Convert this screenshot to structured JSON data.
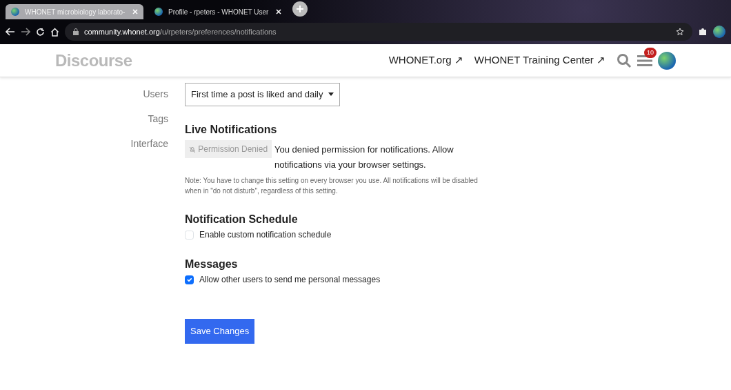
{
  "browser": {
    "tabs": [
      {
        "title": "WHONET microbiology laborato-",
        "selected": true
      },
      {
        "title": "Profile - rpeters - WHONET User",
        "selected": false
      }
    ],
    "address": {
      "host": "community.whonet.org",
      "path": "/u/rpeters/preferences/notifications"
    }
  },
  "header": {
    "logo": "Discourse",
    "links": [
      "WHONET.org ↗",
      "WHONET Training Center ↗"
    ],
    "notification_count": "10"
  },
  "sidebar": {
    "items": [
      "Users",
      "Tags",
      "Interface"
    ]
  },
  "like_notify": {
    "value": "First time a post is liked and daily"
  },
  "live_notifications": {
    "title": "Live Notifications",
    "button": {
      "label": "Permission Denied",
      "disabled": true
    },
    "message": "You denied permission for notifications. Allow notifications via your browser settings.",
    "note": "Note: You have to change this setting on every browser you use. All notifications will be disabled when in \"do not disturb\", regardless of this setting."
  },
  "notification_schedule": {
    "title": "Notification Schedule",
    "option": {
      "label": "Enable custom notification schedule",
      "checked": false
    }
  },
  "messages": {
    "title": "Messages",
    "option": {
      "label": "Allow other users to send me personal messages",
      "checked": true
    }
  },
  "save_button": "Save Changes"
}
